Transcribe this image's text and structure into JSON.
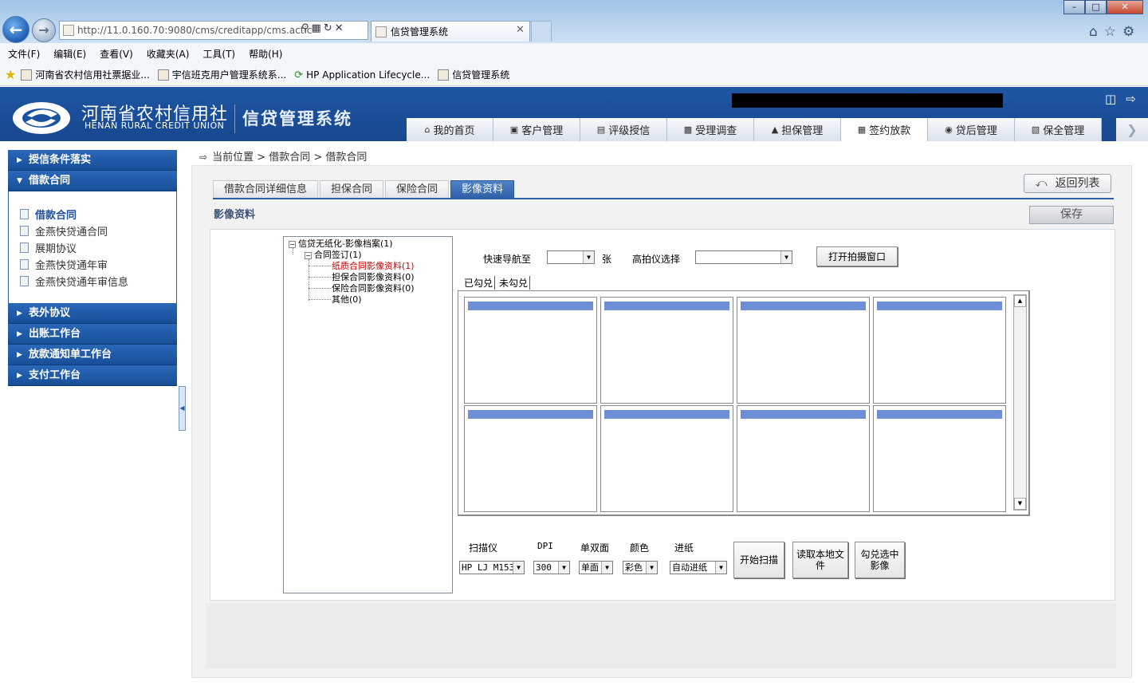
{
  "browser": {
    "url": "http://11.0.160.70:9080/cms/creditapp/cms.actic",
    "tab_title": "信贷管理系统",
    "menu": [
      "文件(F)",
      "编辑(E)",
      "查看(V)",
      "收藏夹(A)",
      "工具(T)",
      "帮助(H)"
    ],
    "favorites": [
      "河南省农村信用社票据业...",
      "宇信班克用户管理系统系...",
      "HP Application Lifecycle...",
      "信贷管理系统"
    ]
  },
  "header": {
    "brand_cn": "河南省农村信用社",
    "brand_en": "HENAN RURAL CREDIT UNION",
    "system_name": "信贷管理系统",
    "nav": [
      {
        "label": "我的首页",
        "icon": "home-icon"
      },
      {
        "label": "客户管理",
        "icon": "customer-icon"
      },
      {
        "label": "评级授信",
        "icon": "rating-icon"
      },
      {
        "label": "受理调查",
        "icon": "survey-icon"
      },
      {
        "label": "担保管理",
        "icon": "guarantee-icon"
      },
      {
        "label": "签约放款",
        "icon": "contract-icon"
      },
      {
        "label": "贷后管理",
        "icon": "postloan-icon"
      },
      {
        "label": "保全管理",
        "icon": "preserve-icon"
      }
    ]
  },
  "sidebar": {
    "groups_top": [
      "授信条件落实",
      "借款合同"
    ],
    "items": [
      "借款合同",
      "金燕快贷通合同",
      "展期协议",
      "金燕快贷通年审",
      "金燕快贷通年审信息"
    ],
    "groups_bottom": [
      "表外协议",
      "出账工作台",
      "放款通知单工作台",
      "支付工作台"
    ]
  },
  "breadcrumb": "当前位置 > 借款合同 > 借款合同",
  "subtabs": [
    "借款合同详细信息",
    "担保合同",
    "保险合同",
    "影像资料"
  ],
  "buttons": {
    "back": "返回列表",
    "save": "保存"
  },
  "section_title": "影像资料",
  "tree": {
    "root": "信贷无纸化-影像档案(1)",
    "child": "合同签订(1)",
    "leaves": [
      "纸质合同影像资料(1)",
      "担保合同影像资料(0)",
      "保险合同影像资料(0)",
      "其他(0)"
    ]
  },
  "scan": {
    "quick_nav_label": "快速导航至",
    "quick_nav_unit": "张",
    "camera_label": "高拍仪选择",
    "open_camera": "打开拍摄窗口",
    "checked_tab": "已勾兑",
    "unchecked_tab": "未勾兑",
    "scanner_label": "扫描仪",
    "scanner_value": "HP LJ M153",
    "dpi_label": "DPI",
    "dpi_value": "300",
    "duplex_label": "单双面",
    "duplex_value": "单面",
    "color_label": "颜色",
    "color_value": "彩色",
    "feed_label": "进纸",
    "feed_value": "自动进纸",
    "start_scan": "开始扫描",
    "read_local": "读取本地文件",
    "check_selected": "勾兑选中影像"
  }
}
